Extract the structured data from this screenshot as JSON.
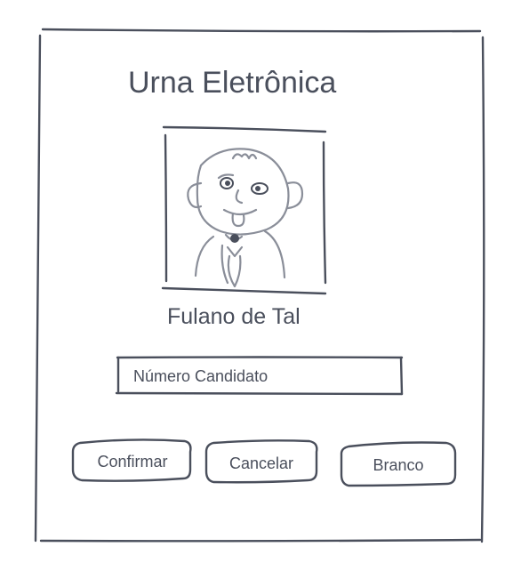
{
  "window": {
    "title": "Urna Eletrônica"
  },
  "candidate": {
    "photo_icon": "person-caricature-icon",
    "name": "Fulano de Tal"
  },
  "number_field": {
    "placeholder": "Número Candidato",
    "value": ""
  },
  "actions": {
    "confirm_label": "Confirmar",
    "cancel_label": "Cancelar",
    "blank_label": "Branco"
  },
  "colors": {
    "ink": "#4a4f5c",
    "sketch_gray": "#8a8e99",
    "background": "#ffffff"
  }
}
